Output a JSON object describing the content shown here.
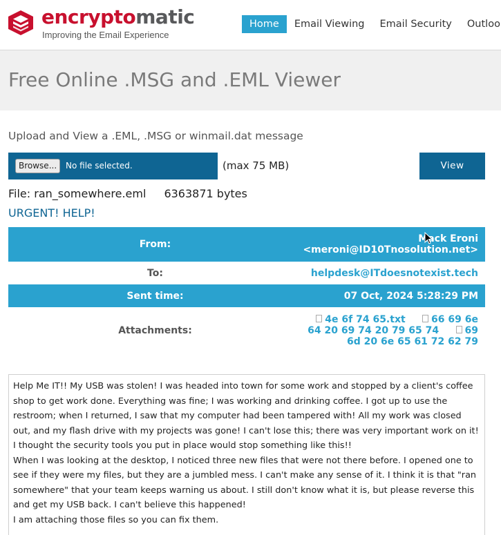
{
  "brand": {
    "name_part1": "encrypto",
    "name_part2": "matic",
    "tagline": "Improving the Email Experience",
    "color_primary": "#c8102e",
    "color_secondary": "#58595b"
  },
  "nav": {
    "items": [
      "Home",
      "Email Viewing",
      "Email Security",
      "Outlook"
    ],
    "active": "Home"
  },
  "banner": {
    "title": "Free Online .MSG and .EML Viewer"
  },
  "upload": {
    "heading": "Upload and View a .EML, .MSG or winmail.dat message",
    "browse_label": "Browse...",
    "no_file_label": "No file selected.",
    "max_size": "(max 75 MB)",
    "view_label": "View"
  },
  "file_info": {
    "file_text": "File: ran_somewhere.eml",
    "size_text": "6363871 bytes"
  },
  "message": {
    "subject": "URGENT! HELP!",
    "from_label": "From:",
    "from_name": "Mack Eroni",
    "from_email": "<meroni@ID10Tnosolution.net>",
    "to_label": "To:",
    "to_value": "helpdesk@ITdoesnotexist.tech",
    "sent_label": "Sent time:",
    "sent_value": "07 Oct, 2024 5:28:29 PM",
    "attachments_label": "Attachments:",
    "attachments": [
      "4e 6f 74 65.txt",
      "66 69 6e 64 20 69 74 20 79 65 74",
      "69 6d 20 6e 65 61 72 62 79"
    ],
    "body": [
      "Help Me IT!! My USB was stolen! I was headed into town for some work and stopped by a client's coffee shop to get work done. Everything was fine; I was working and drinking coffee. I got up to use the restroom; when I returned, I saw that my computer had been tampered with! All my work was closed out, and my flash drive with my projects was gone! I can't lose this; there was very important work on it! I thought the security tools you put in place would stop something like this!!",
      "When I was looking at the desktop, I noticed three new files that were not there before. I opened one to see if they were my files, but they are a jumbled mess. I can't make any sense of it. I think it is that \"ran somewhere\" that your team keeps warning us about. I still don't know what it is, but please reverse this and get my USB back. I can't believe this happened!",
      "I am attaching those files so you can fix them."
    ]
  },
  "colors": {
    "accent": "#2aa2cf",
    "dark_blue": "#0f6593"
  }
}
